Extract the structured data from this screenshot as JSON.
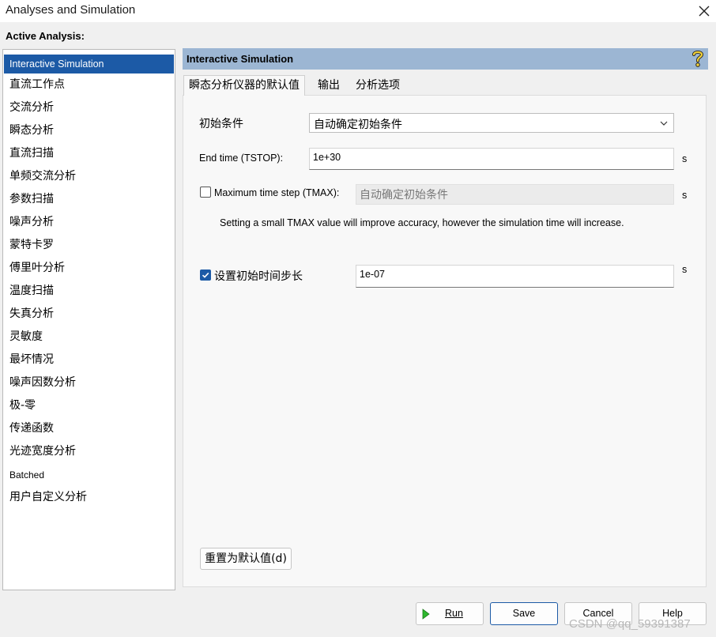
{
  "window": {
    "title": "Analyses and Simulation"
  },
  "active_analysis_label": "Active Analysis:",
  "sidebar": {
    "items": [
      {
        "label": "Interactive Simulation",
        "selected": true
      },
      {
        "label": "直流工作点"
      },
      {
        "label": "交流分析"
      },
      {
        "label": "瞬态分析"
      },
      {
        "label": "直流扫描"
      },
      {
        "label": "单频交流分析"
      },
      {
        "label": "参数扫描"
      },
      {
        "label": "噪声分析"
      },
      {
        "label": "蒙特卡罗"
      },
      {
        "label": "傅里叶分析"
      },
      {
        "label": "温度扫描"
      },
      {
        "label": "失真分析"
      },
      {
        "label": "灵敏度"
      },
      {
        "label": "最坏情况"
      },
      {
        "label": "噪声因数分析"
      },
      {
        "label": "极-零"
      },
      {
        "label": "传递函数"
      },
      {
        "label": "光迹宽度分析"
      },
      {
        "label": "Batched"
      },
      {
        "label": "用户自定义分析"
      }
    ]
  },
  "panel": {
    "title": "Interactive Simulation",
    "tabs": [
      {
        "label": "瞬态分析仪器的默认值",
        "active": true
      },
      {
        "label": "输出"
      },
      {
        "label": "分析选项"
      }
    ],
    "initial_conditions": {
      "label": "初始条件",
      "value": "自动确定初始条件"
    },
    "end_time": {
      "label": "End time (TSTOP):",
      "value": "1e+30",
      "unit": "s"
    },
    "max_time_step": {
      "label": "Maximum time step (TMAX):",
      "checked": false,
      "value": "自动确定初始条件",
      "unit": "s"
    },
    "note": "Setting a small TMAX value will improve accuracy, however the simulation time will increase.",
    "initial_step": {
      "label": "设置初始时间步长",
      "checked": true,
      "value": "1e-07",
      "unit": "s"
    },
    "reset_button": "重置为默认值(d)"
  },
  "footer": {
    "run": "Run",
    "save": "Save",
    "cancel": "Cancel",
    "help": "Help"
  },
  "watermark": "CSDN @qq_59391387",
  "colors": {
    "selection": "#1c5aa6",
    "panel_header": "#9cb6d3"
  }
}
